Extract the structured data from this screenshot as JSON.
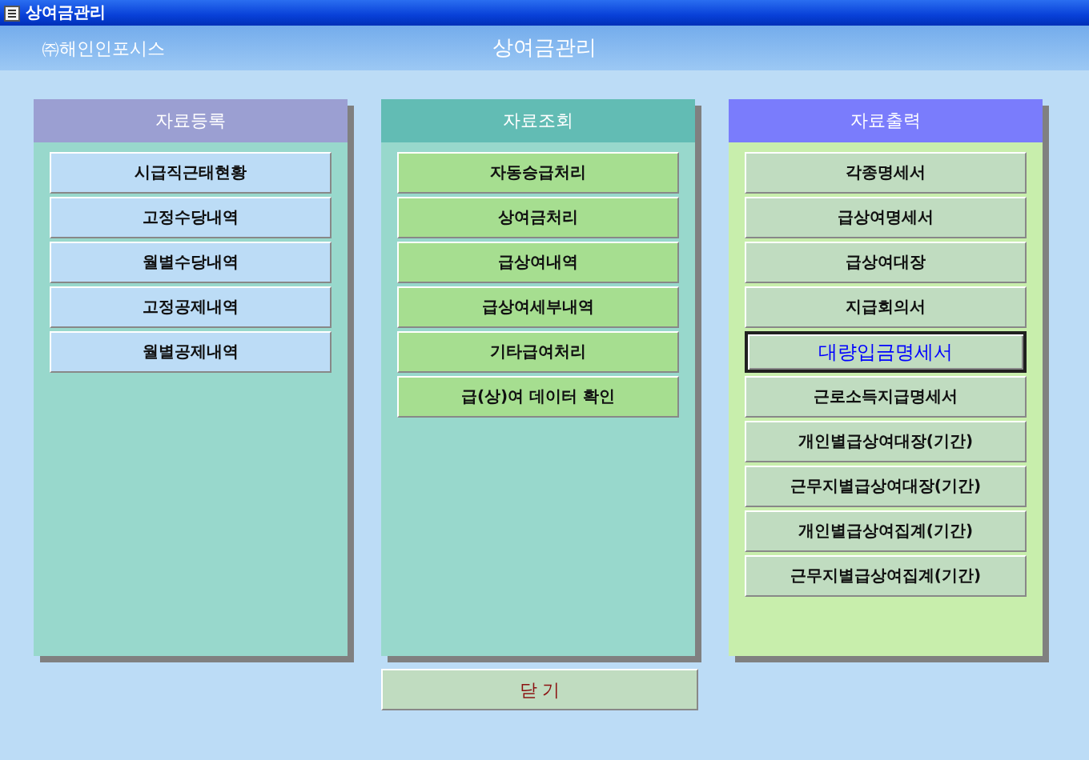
{
  "window": {
    "title": "상여금관리"
  },
  "header": {
    "company": "㈜해인인포시스",
    "title": "상여금관리"
  },
  "panels": [
    {
      "kind": "register",
      "title": "자료등록",
      "buttons": [
        {
          "label": "시급직근태현황",
          "selected": false
        },
        {
          "label": "고정수당내역",
          "selected": false
        },
        {
          "label": "월별수당내역",
          "selected": false
        },
        {
          "label": "고정공제내역",
          "selected": false
        },
        {
          "label": "월별공제내역",
          "selected": false
        }
      ]
    },
    {
      "kind": "query",
      "title": "자료조회",
      "buttons": [
        {
          "label": "자동승급처리",
          "selected": false
        },
        {
          "label": "상여금처리",
          "selected": false
        },
        {
          "label": "급상여내역",
          "selected": false
        },
        {
          "label": "급상여세부내역",
          "selected": false
        },
        {
          "label": "기타급여처리",
          "selected": false
        },
        {
          "label": "급(상)여 데이터 확인",
          "selected": false
        }
      ]
    },
    {
      "kind": "output",
      "title": "자료출력",
      "buttons": [
        {
          "label": "각종명세서",
          "selected": false
        },
        {
          "label": "급상여명세서",
          "selected": false
        },
        {
          "label": "급상여대장",
          "selected": false
        },
        {
          "label": "지급회의서",
          "selected": false
        },
        {
          "label": "대량입금명세서",
          "selected": true
        },
        {
          "label": "근로소득지급명세서",
          "selected": false
        },
        {
          "label": "개인별급상여대장(기간)",
          "selected": false
        },
        {
          "label": "근무지별급상여대장(기간)",
          "selected": false
        },
        {
          "label": "개인별급상여집계(기간)",
          "selected": false
        },
        {
          "label": "근무지별급상여집계(기간)",
          "selected": false
        }
      ]
    }
  ],
  "close_button": "닫 기"
}
